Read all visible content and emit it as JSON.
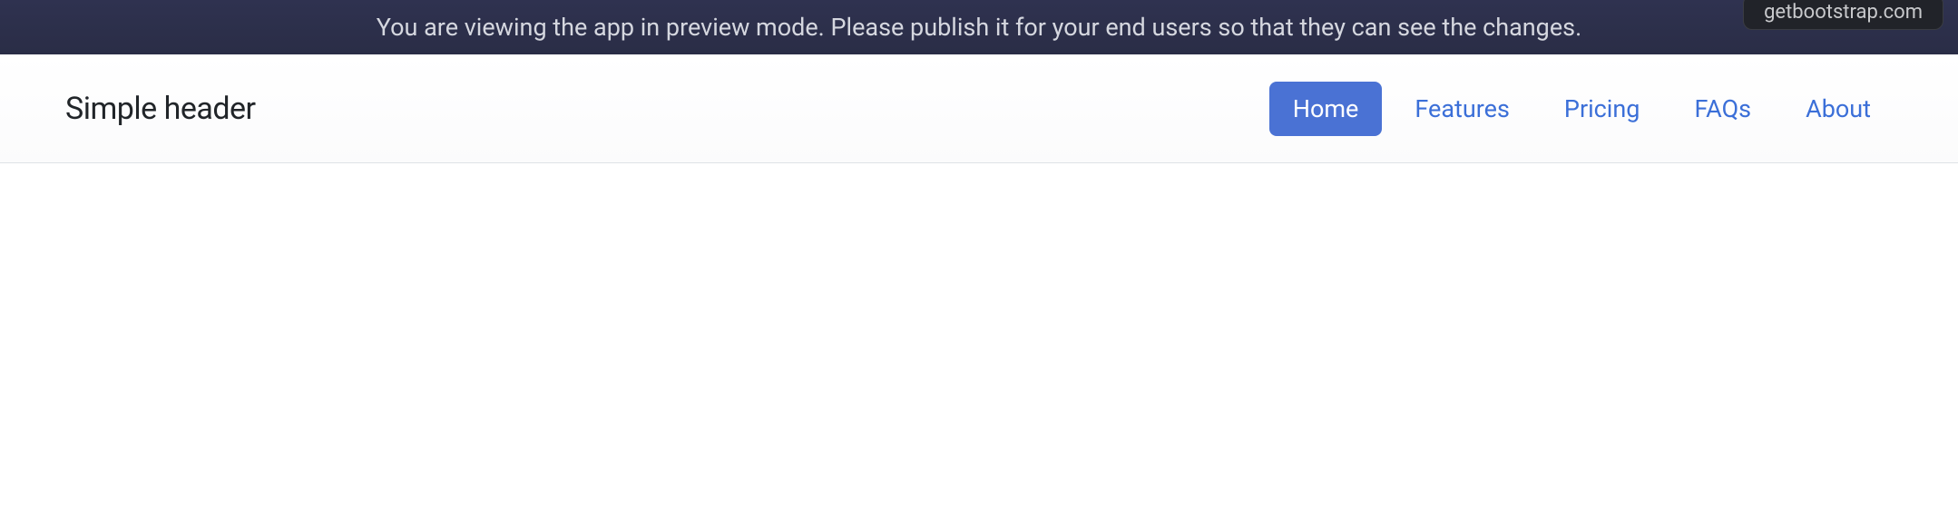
{
  "banner": {
    "message": "You are viewing the app in preview mode. Please publish it for your end users so that they can see the changes.",
    "source_badge": "getbootstrap.com"
  },
  "header": {
    "brand": "Simple header",
    "nav": [
      {
        "label": "Home",
        "active": true
      },
      {
        "label": "Features",
        "active": false
      },
      {
        "label": "Pricing",
        "active": false
      },
      {
        "label": "FAQs",
        "active": false
      },
      {
        "label": "About",
        "active": false
      }
    ]
  }
}
